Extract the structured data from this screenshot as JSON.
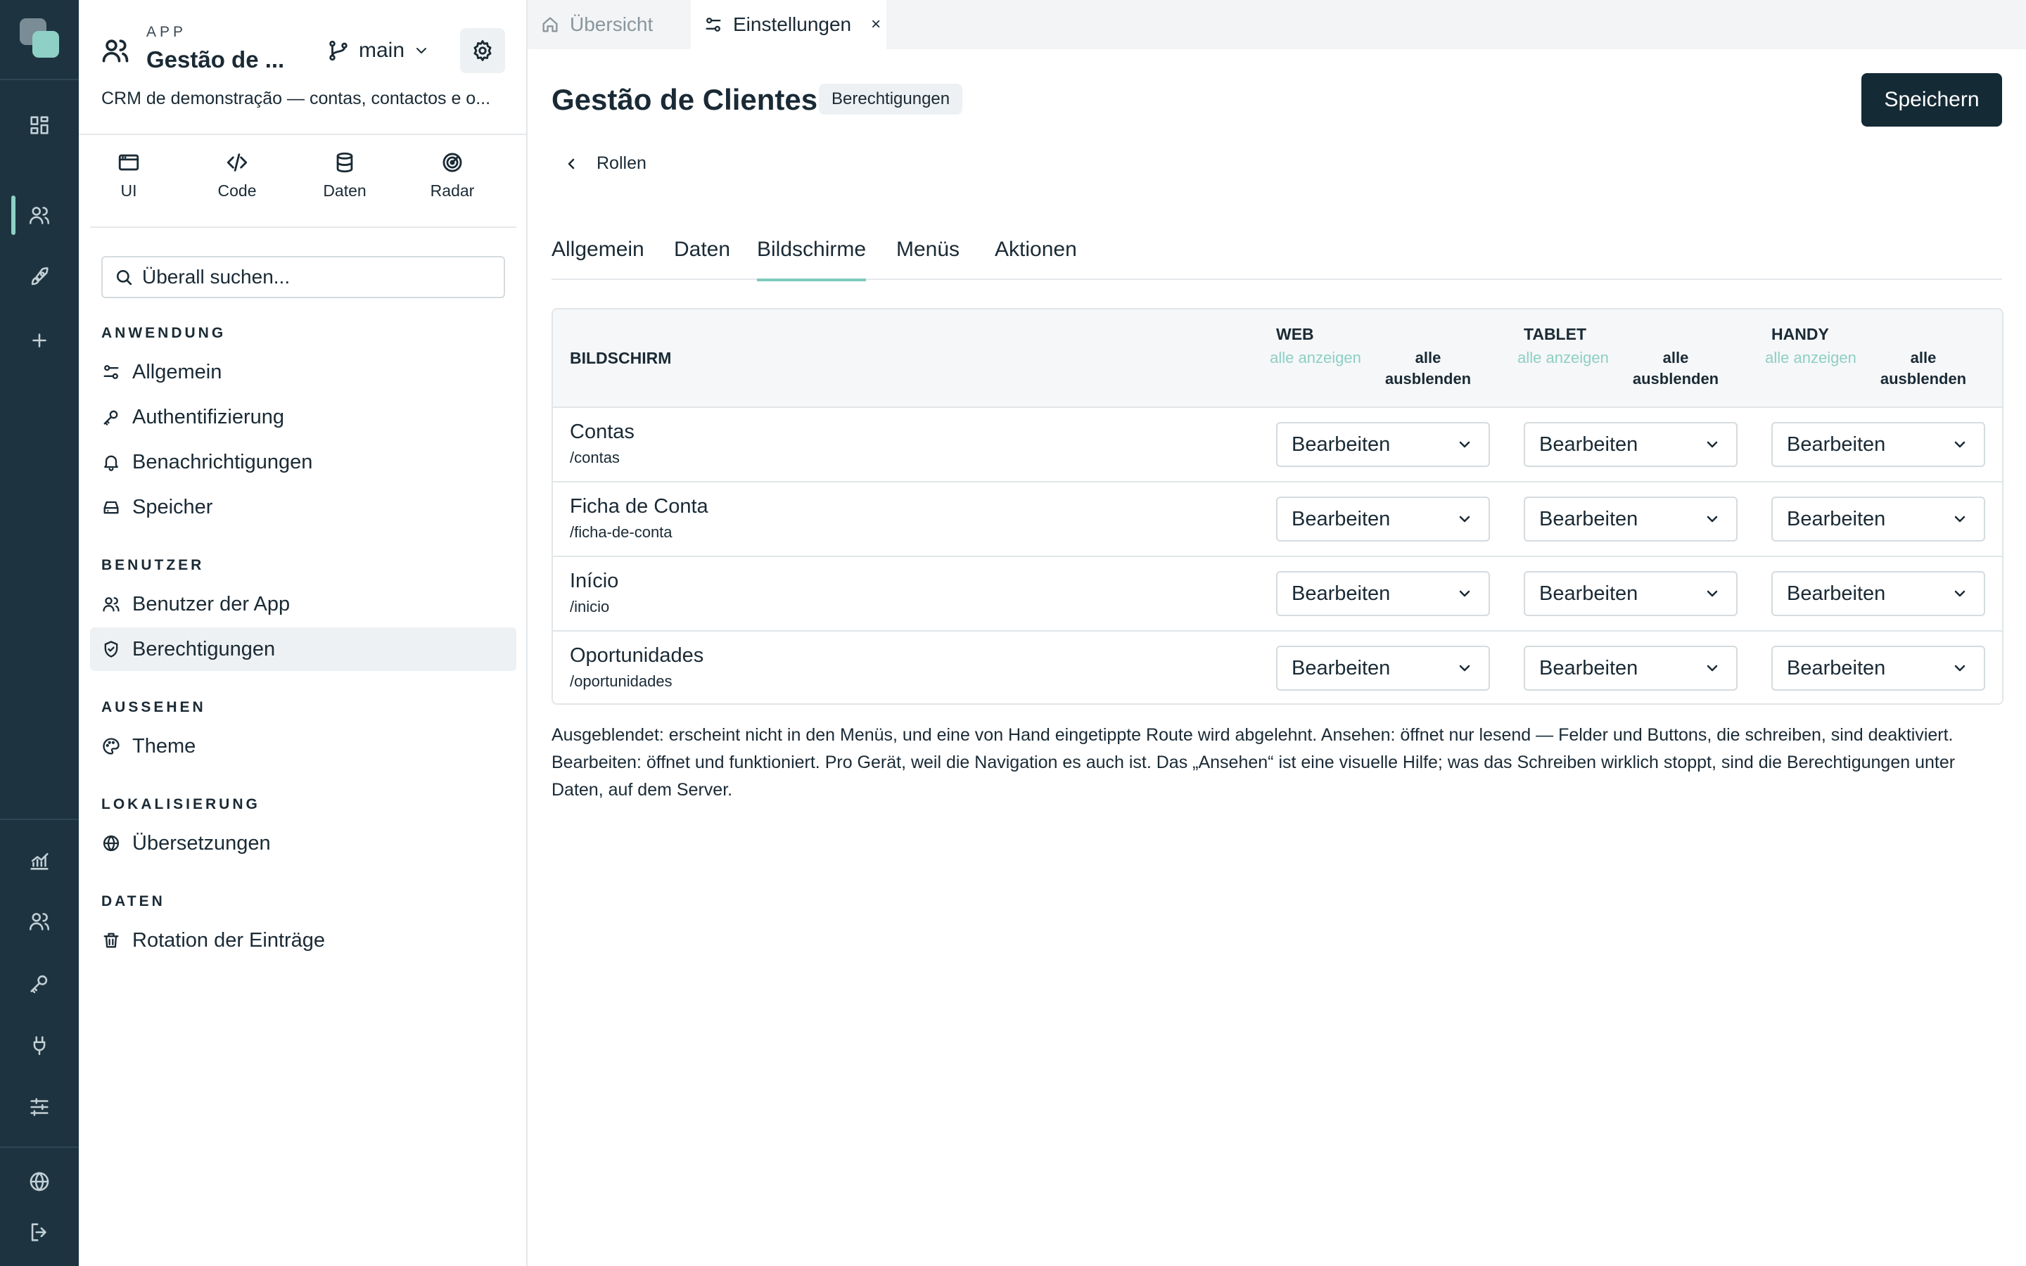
{
  "rail": {
    "icons": [
      "dashboard-icon",
      "users-icon",
      "rocket-icon",
      "plus-icon",
      "analytics-icon",
      "team-icon",
      "key-icon",
      "plug-icon",
      "sliders-icon",
      "globe-icon",
      "logout-icon"
    ],
    "accent": "#8fd0c6"
  },
  "app": {
    "kicker": "APP",
    "name": "Gestão de ...",
    "branch": "main",
    "description": "CRM de demonstração — contas, contactos e o..."
  },
  "quick_links": [
    {
      "label": "UI",
      "icon": "window-icon"
    },
    {
      "label": "Code",
      "icon": "code-icon"
    },
    {
      "label": "Daten",
      "icon": "database-icon"
    },
    {
      "label": "Radar",
      "icon": "radar-icon"
    }
  ],
  "search": {
    "placeholder": "Überall suchen..."
  },
  "nav": {
    "anwendung": {
      "title": "ANWENDUNG",
      "items": [
        "Allgemein",
        "Authentifizierung",
        "Benachrichtigungen",
        "Speicher"
      ]
    },
    "benutzer": {
      "title": "BENUTZER",
      "items": [
        "Benutzer der App",
        "Berechtigungen"
      ]
    },
    "aussehen": {
      "title": "AUSSEHEN",
      "items": [
        "Theme"
      ]
    },
    "lokalisierung": {
      "title": "LOKALISIERUNG",
      "items": [
        "Übersetzungen"
      ]
    },
    "daten": {
      "title": "DATEN",
      "items": [
        "Rotation der Einträge"
      ]
    }
  },
  "window_tabs": [
    {
      "label": "Übersicht",
      "active": false
    },
    {
      "label": "Einstellungen",
      "active": true,
      "close": "×"
    }
  ],
  "header": {
    "title": "Gestão de Clientes",
    "badge": "Berechtigungen",
    "save_label": "Speichern",
    "back_label": "Rollen"
  },
  "page_tabs": [
    "Allgemein",
    "Daten",
    "Bildschirme",
    "Menüs",
    "Aktionen"
  ],
  "active_page_tab": "Bildschirme",
  "table": {
    "col_screen": "BILDSCHIRM",
    "devices": [
      "WEB",
      "TABLET",
      "HANDY"
    ],
    "show_all": "alle anzeigen",
    "hide_all": "alle ausblenden",
    "rows": [
      {
        "name": "Contas",
        "path": "/contas",
        "web": "Bearbeiten",
        "tablet": "Bearbeiten",
        "handy": "Bearbeiten"
      },
      {
        "name": "Ficha de Conta",
        "path": "/ficha-de-conta",
        "web": "Bearbeiten",
        "tablet": "Bearbeiten",
        "handy": "Bearbeiten"
      },
      {
        "name": "Início",
        "path": "/inicio",
        "web": "Bearbeiten",
        "tablet": "Bearbeiten",
        "handy": "Bearbeiten"
      },
      {
        "name": "Oportunidades",
        "path": "/oportunidades",
        "web": "Bearbeiten",
        "tablet": "Bearbeiten",
        "handy": "Bearbeiten"
      }
    ]
  },
  "help_text": "Ausgeblendet: erscheint nicht in den Menüs, und eine von Hand eingetippte Route wird abgelehnt. Ansehen: öffnet nur lesend — Felder und Buttons, die schreiben, sind deaktiviert. Bearbeiten: öffnet und funktioniert. Pro Gerät, weil die Navigation es auch ist. Das „Ansehen“ ist eine visuelle Hilfe; was das Schreiben wirklich stoppt, sind die Berechtigungen unter Daten, auf dem Server.",
  "colors": {
    "dark": "#142a35",
    "rail": "#1d3440",
    "accent": "#7fcbbd"
  }
}
